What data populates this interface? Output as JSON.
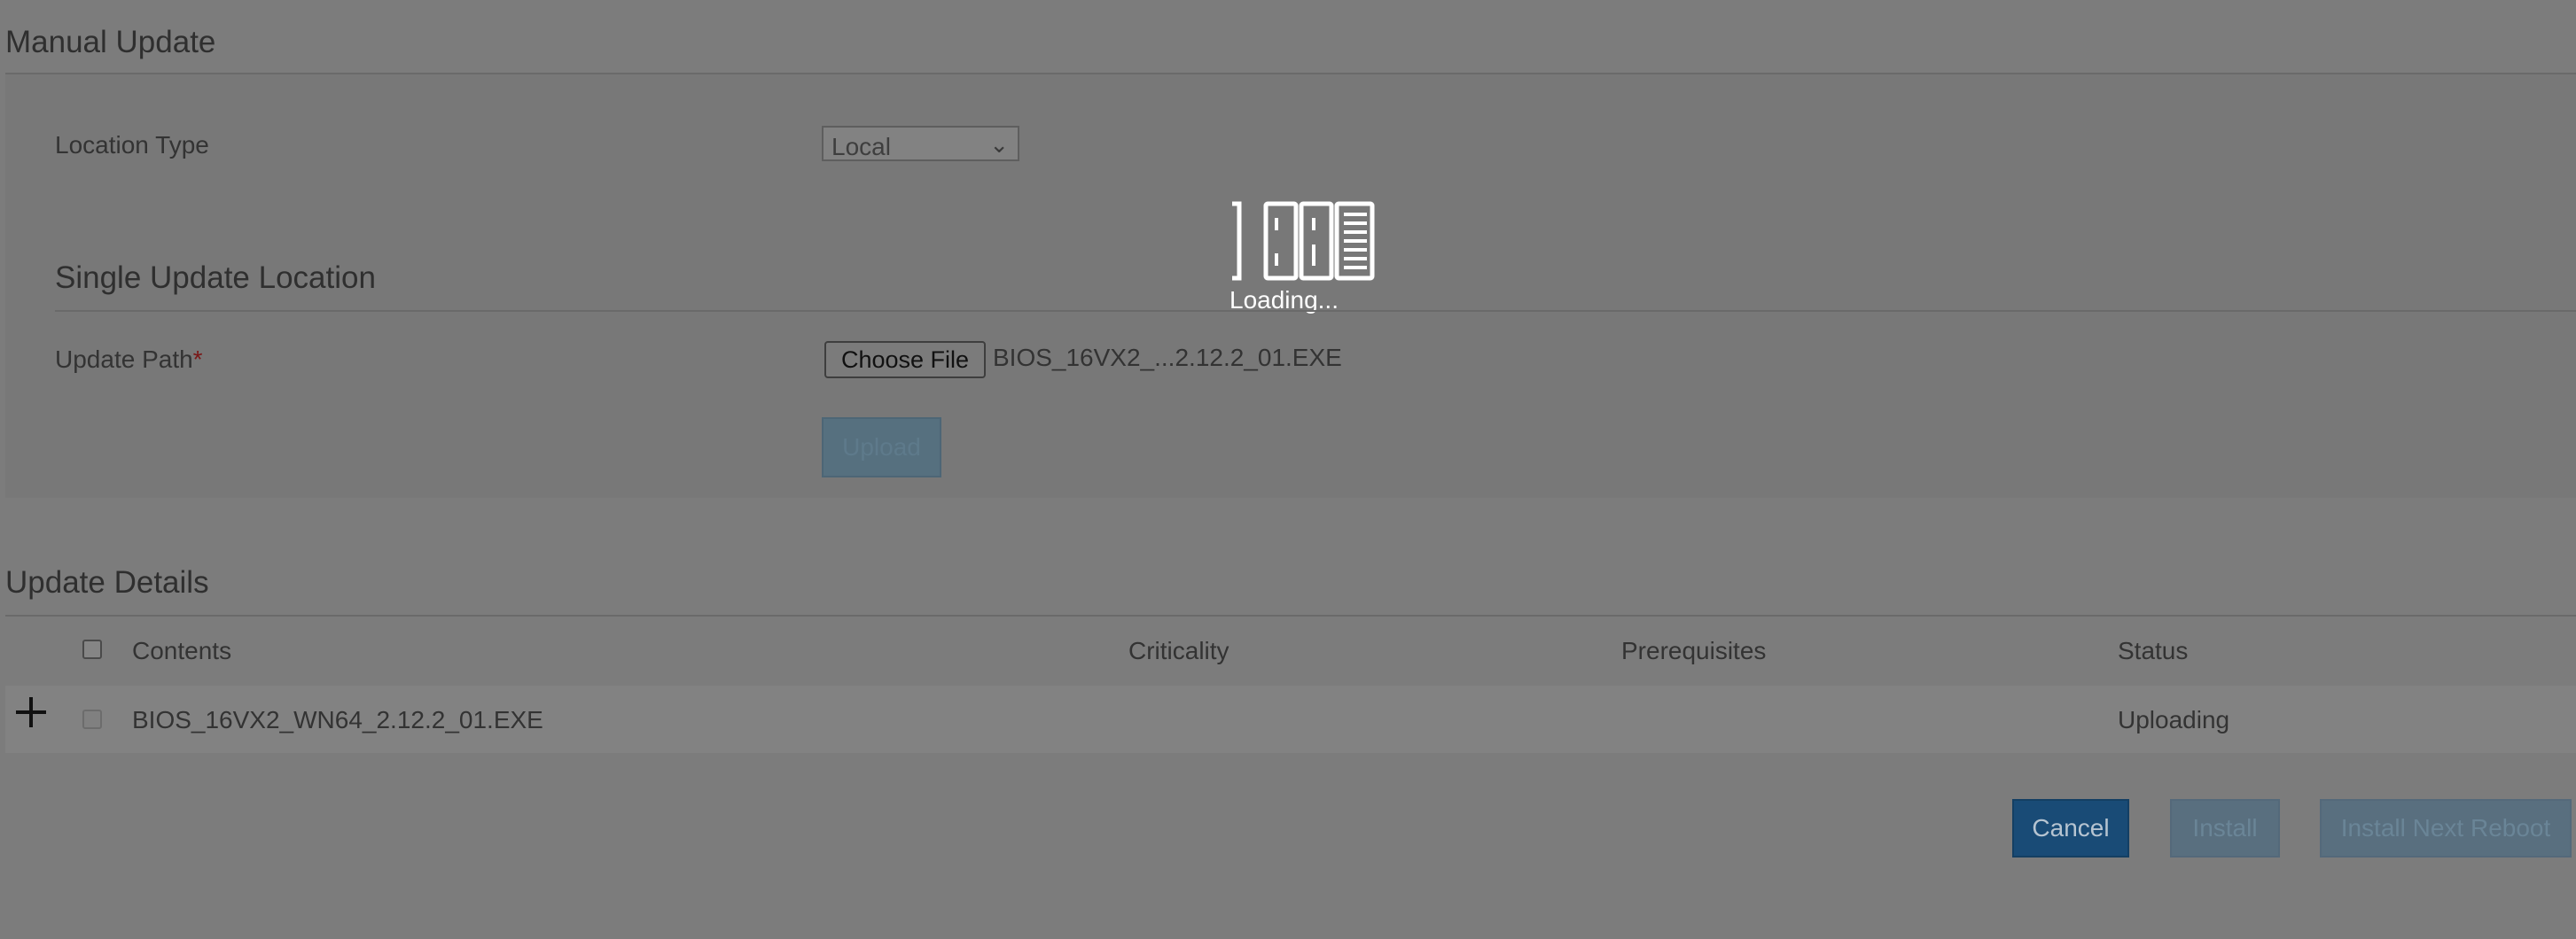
{
  "manual_update": {
    "title": "Manual Update",
    "location_type_label": "Location Type",
    "location_type_value": "Local"
  },
  "single_update": {
    "title": "Single Update Location",
    "update_path_label": "Update Path",
    "required_marker": "*",
    "choose_file_label": "Choose File",
    "file_name": "BIOS_16VX2_...2.12.2_01.EXE",
    "upload_label": "Upload"
  },
  "loading": {
    "text": "Loading..."
  },
  "update_details": {
    "title": "Update Details",
    "columns": [
      "Contents",
      "Criticality",
      "Prerequisites",
      "Status"
    ],
    "rows": [
      {
        "contents": "BIOS_16VX2_WN64_2.12.2_01.EXE",
        "criticality": "",
        "prerequisites": "",
        "status": "Uploading"
      }
    ]
  },
  "actions": {
    "cancel": "Cancel",
    "install": "Install",
    "install_next_reboot": "Install Next Reboot"
  },
  "colors": {
    "overlay_background": "#7c7c7c",
    "primary_button": "#194b76",
    "disabled_button": "#596f7f",
    "required": "#7a1717"
  }
}
